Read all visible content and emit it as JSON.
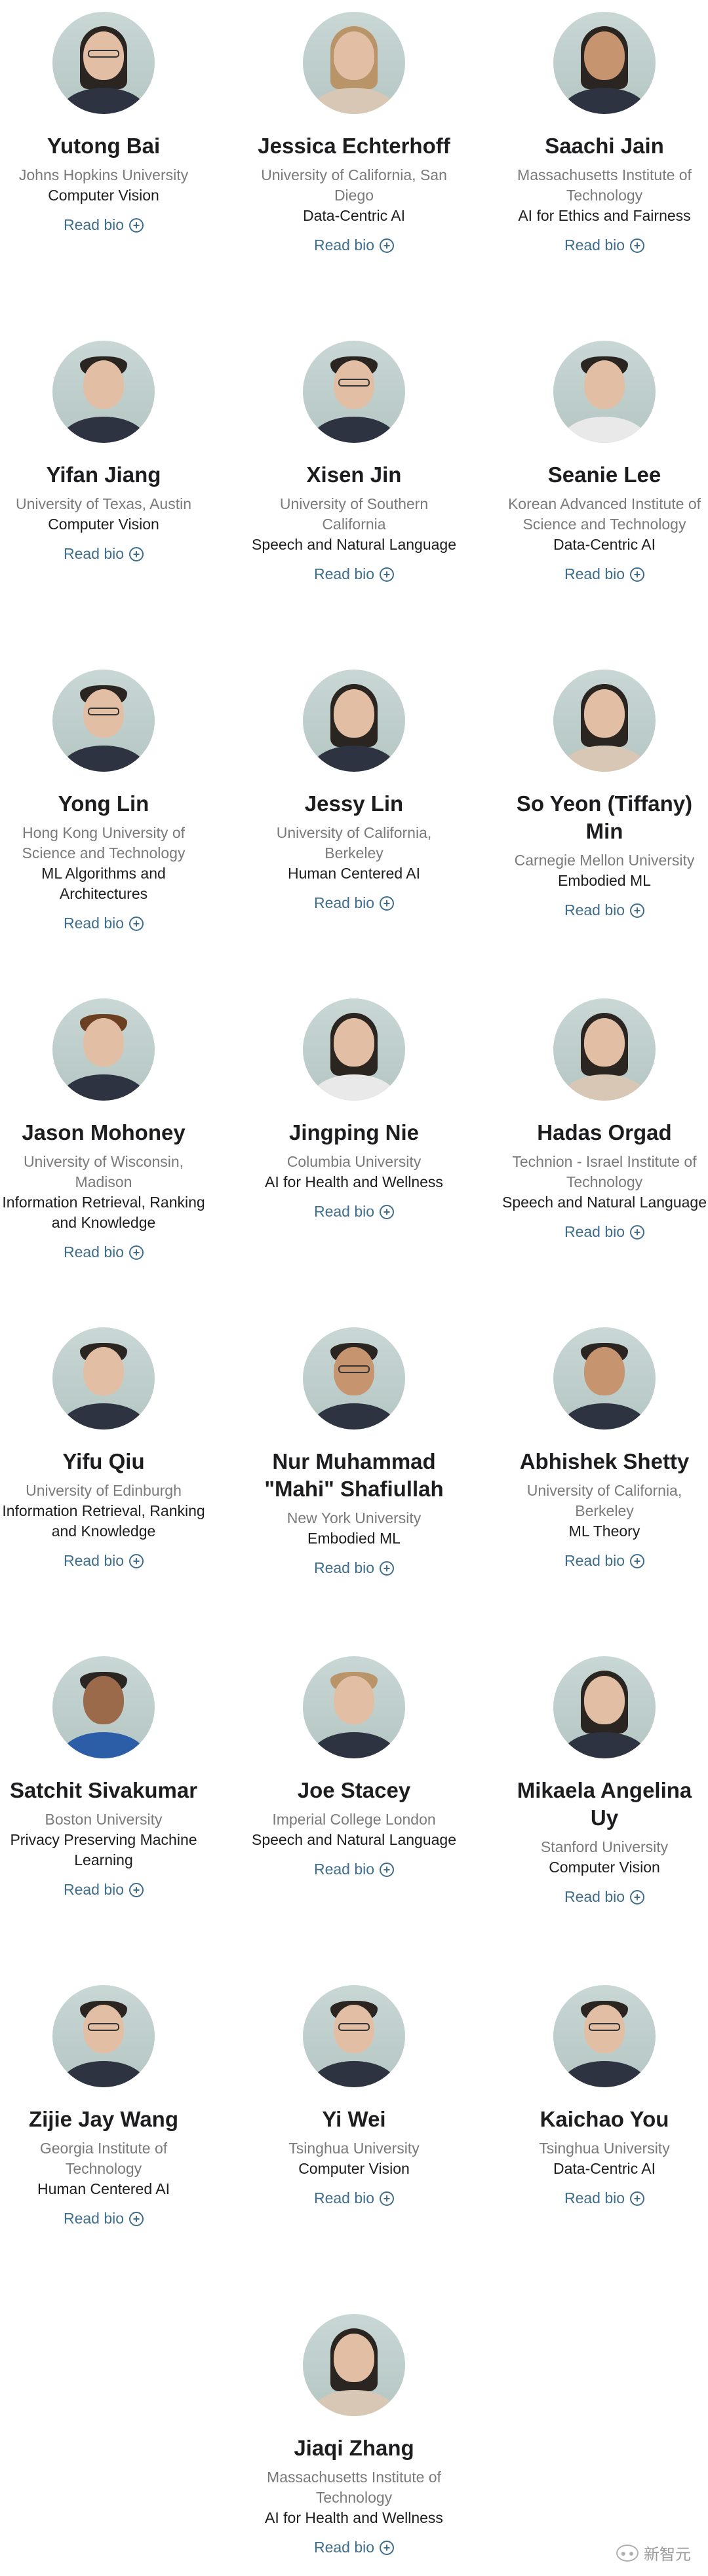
{
  "profiles": [
    {
      "name": "Yutong Bai",
      "university": "Johns Hopkins University",
      "area": "Computer Vision",
      "bio_label": "Read bio"
    },
    {
      "name": "Jessica Echterhoff",
      "university": "University of California, San Diego",
      "area": "Data-Centric AI",
      "bio_label": "Read bio"
    },
    {
      "name": "Saachi Jain",
      "university": "Massachusetts Institute of Technology",
      "area": "AI for Ethics and Fairness",
      "bio_label": "Read bio"
    },
    {
      "name": "Yifan Jiang",
      "university": "University of Texas, Austin",
      "area": "Computer Vision",
      "bio_label": "Read bio"
    },
    {
      "name": "Xisen Jin",
      "university": "University of Southern California",
      "area": "Speech and Natural Language",
      "bio_label": "Read bio"
    },
    {
      "name": "Seanie Lee",
      "university": "Korean Advanced Institute of Science and Technology",
      "area": "Data-Centric AI",
      "bio_label": "Read bio"
    },
    {
      "name": "Yong Lin",
      "university": "Hong Kong University of Science and Technology",
      "area": "ML Algorithms and Architectures",
      "bio_label": "Read bio"
    },
    {
      "name": "Jessy Lin",
      "university": "University of California, Berkeley",
      "area": "Human Centered AI",
      "bio_label": "Read bio"
    },
    {
      "name": "So Yeon (Tiffany) Min",
      "university": "Carnegie Mellon University",
      "area": "Embodied ML",
      "bio_label": "Read bio"
    },
    {
      "name": "Jason Mohoney",
      "university": "University of Wisconsin, Madison",
      "area": "Information Retrieval, Ranking and Knowledge",
      "bio_label": "Read bio"
    },
    {
      "name": "Jingping Nie",
      "university": "Columbia University",
      "area": "AI for Health and Wellness",
      "bio_label": "Read bio"
    },
    {
      "name": "Hadas Orgad",
      "university": "Technion - Israel Institute of Technology",
      "area": "Speech and Natural Language",
      "bio_label": "Read bio"
    },
    {
      "name": "Yifu Qiu",
      "university": "University of Edinburgh",
      "area": "Information Retrieval, Ranking and Knowledge",
      "bio_label": "Read bio"
    },
    {
      "name": "Nur Muhammad \"Mahi\" Shafiullah",
      "university": "New York University",
      "area": "Embodied ML",
      "bio_label": "Read bio"
    },
    {
      "name": "Abhishek Shetty",
      "university": "University of California, Berkeley",
      "area": "ML Theory",
      "bio_label": "Read bio"
    },
    {
      "name": "Satchit Sivakumar",
      "university": "Boston University",
      "area": "Privacy Preserving Machine Learning",
      "bio_label": "Read bio"
    },
    {
      "name": "Joe Stacey",
      "university": "Imperial College London",
      "area": "Speech and Natural Language",
      "bio_label": "Read bio"
    },
    {
      "name": "Mikaela Angelina Uy",
      "university": "Stanford University",
      "area": "Computer Vision",
      "bio_label": "Read bio"
    },
    {
      "name": "Zijie Jay Wang",
      "university": "Georgia Institute of Technology",
      "area": "Human Centered AI",
      "bio_label": "Read bio"
    },
    {
      "name": "Yi Wei",
      "university": "Tsinghua University",
      "area": "Computer Vision",
      "bio_label": "Read bio"
    },
    {
      "name": "Kaichao You",
      "university": "Tsinghua University",
      "area": "Data-Centric AI",
      "bio_label": "Read bio"
    },
    {
      "name": "Jiaqi Zhang",
      "university": "Massachusetts Institute of Technology",
      "area": "AI for Health and Wellness",
      "bio_label": "Read bio"
    }
  ],
  "icons": {
    "bio": "plus-circle-icon",
    "avatar": "profile-photo"
  },
  "watermark": {
    "text": "新智元",
    "icon": "wechat-icon"
  },
  "colors": {
    "link": "#3f6e8c",
    "secondary_text": "#7a7a7a",
    "primary_text": "#1d1d1f"
  }
}
